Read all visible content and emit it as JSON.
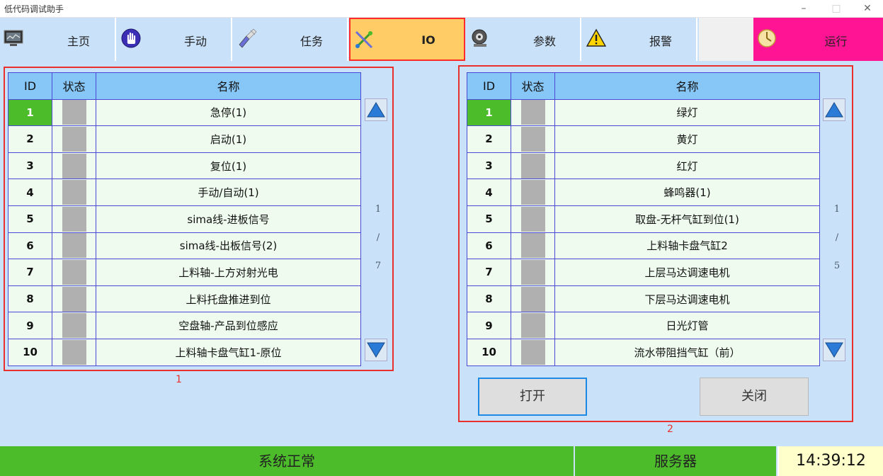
{
  "window": {
    "title": "低代码调试助手"
  },
  "nav": {
    "items": [
      {
        "label": "主页",
        "icon": "monitor-icon"
      },
      {
        "label": "手动",
        "icon": "hand-icon"
      },
      {
        "label": "任务",
        "icon": "brush-icon"
      },
      {
        "label": "IO",
        "icon": "io-icon"
      },
      {
        "label": "参数",
        "icon": "settings-icon"
      },
      {
        "label": "报警",
        "icon": "warning-icon"
      },
      {
        "label": "",
        "icon": ""
      },
      {
        "label": "运行",
        "icon": "run-icon"
      }
    ],
    "active": "IO"
  },
  "inputs": {
    "caption": "1",
    "headers": [
      "ID",
      "状态",
      "名称"
    ],
    "rows": [
      {
        "id": "1",
        "name": "急停(1)"
      },
      {
        "id": "2",
        "name": "启动(1)"
      },
      {
        "id": "3",
        "name": "复位(1)"
      },
      {
        "id": "4",
        "name": "手动/自动(1)"
      },
      {
        "id": "5",
        "name": "sima线-进板信号"
      },
      {
        "id": "6",
        "name": "sima线-出板信号(2)"
      },
      {
        "id": "7",
        "name": "上料轴-上方对射光电"
      },
      {
        "id": "8",
        "name": "上料托盘推进到位"
      },
      {
        "id": "9",
        "name": "空盘轴-产品到位感应"
      },
      {
        "id": "10",
        "name": "上料轴卡盘气缸1-原位"
      }
    ],
    "pager": {
      "current": "1",
      "sep": "/",
      "total": "7"
    }
  },
  "outputs": {
    "caption": "2",
    "headers": [
      "ID",
      "状态",
      "名称"
    ],
    "rows": [
      {
        "id": "1",
        "name": "绿灯"
      },
      {
        "id": "2",
        "name": "黄灯"
      },
      {
        "id": "3",
        "name": "红灯"
      },
      {
        "id": "4",
        "name": "蜂鸣器(1)"
      },
      {
        "id": "5",
        "name": "取盘-无杆气缸到位(1)"
      },
      {
        "id": "6",
        "name": "上料轴卡盘气缸2"
      },
      {
        "id": "7",
        "name": "上层马达调速电机"
      },
      {
        "id": "8",
        "name": "下层马达调速电机"
      },
      {
        "id": "9",
        "name": "日光灯管"
      },
      {
        "id": "10",
        "name": "流水带阻挡气缸（前）"
      }
    ],
    "pager": {
      "current": "1",
      "sep": "/",
      "total": "5"
    },
    "open_label": "打开",
    "close_label": "关闭"
  },
  "status": {
    "system": "系统正常",
    "server": "服务器",
    "time": "14:39:12"
  }
}
